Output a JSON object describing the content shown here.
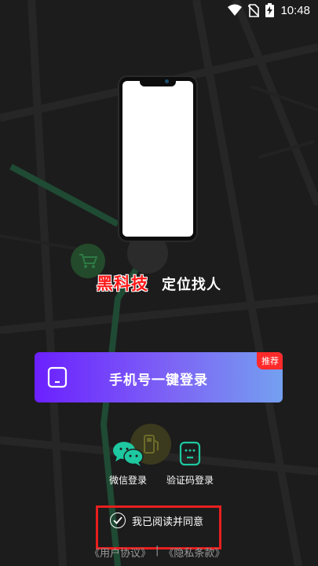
{
  "status_bar": {
    "time": "10:48",
    "icons": [
      "wifi-icon",
      "no-sim-icon",
      "battery-charging-icon"
    ]
  },
  "brand": {
    "name": "黑科技",
    "tagline": "定位找人"
  },
  "login": {
    "one_click_label": "手机号一键登录",
    "badge": "推荐"
  },
  "alt_login": [
    {
      "label": "微信登录",
      "icon": "wechat-icon",
      "color": "#1ec8a0"
    },
    {
      "label": "验证码登录",
      "icon": "sms-code-icon",
      "color": "#1ec8a0"
    }
  ],
  "agreement": {
    "agree_text": "我已阅读并同意",
    "user_agreement": "《用户协议》",
    "separator": "|",
    "privacy_policy": "《隐私条款》"
  },
  "colors": {
    "background": "#1c1c1c",
    "brand_red": "#ff1a1a",
    "button_gradient_start": "#6b20ff",
    "button_gradient_end": "#74a0f0",
    "badge_red": "#ff2a2a",
    "accent_teal": "#1ec8a0"
  }
}
